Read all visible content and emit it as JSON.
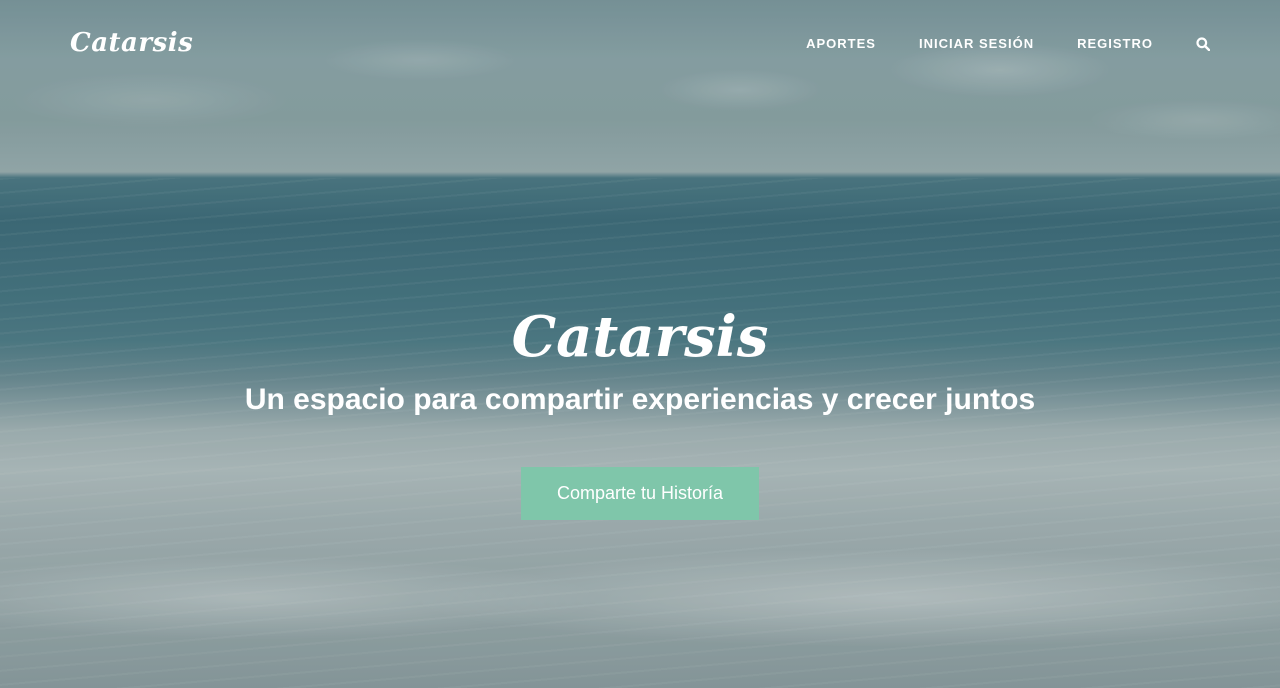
{
  "brand": {
    "name": "Catarsis"
  },
  "nav": {
    "items": [
      {
        "label": "APORTES"
      },
      {
        "label": "INICIAR SESIÓN"
      },
      {
        "label": "REGISTRO"
      }
    ],
    "search_icon": "search-icon"
  },
  "hero": {
    "title": "Catarsis",
    "subtitle": "Un espacio para compartir experiencias y crecer juntos",
    "cta_label": "Comparte tu Historía"
  },
  "colors": {
    "accent": "#7fc6aa",
    "text": "#ffffff"
  }
}
